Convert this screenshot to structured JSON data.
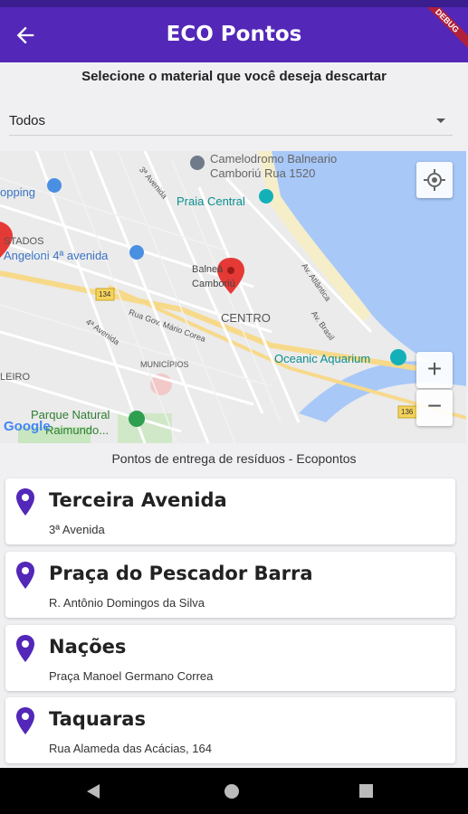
{
  "app": {
    "title": "ECO Pontos",
    "debug_banner": "DEBUG",
    "accent_color": "#5327b8",
    "pin_color": "#5327b8"
  },
  "header": {
    "back_icon": "arrow-back-icon"
  },
  "filter": {
    "prompt": "Selecione o material que você deseja descartar",
    "selected": "Todos"
  },
  "map": {
    "labels": {
      "camelodromo": "Camelodromo Balneario",
      "camelodromo2": "Camboriú Rua 1520",
      "praia": "Praia Central",
      "shopping": "opping",
      "angeloni": "Angeloni 4ª avenida",
      "estados": "STADOS",
      "balneario": "Balneá",
      "camboriu": "Camboriú",
      "centro": "CENTRO",
      "avenida3": "3ª Avenida",
      "avenida4": "4ª Avenida",
      "municipios": "MUNICÍPIOS",
      "ruagov": "Rua Gov. Mário Corea",
      "oceanic": "Oceanic Aquarium",
      "parque": "Parque Natural",
      "raimundo": "Raimundo...",
      "ileiro": "LEIRO",
      "atlantica": "Av. Atlântica",
      "brasil": "Av. Brasil",
      "r134": "134",
      "r136": "136",
      "google": "Google"
    },
    "zoom_in": "+",
    "zoom_out": "−",
    "locate_icon": "my-location-icon"
  },
  "list": {
    "heading": "Pontos de entrega de resíduos - Ecopontos",
    "items": [
      {
        "name": "Terceira Avenida",
        "address": "3ª Avenida"
      },
      {
        "name": "Praça do Pescador Barra",
        "address": "R. Antônio Domingos da Silva"
      },
      {
        "name": "Nações",
        "address": "Praça Manoel Germano Correa"
      },
      {
        "name": "Taquaras",
        "address": "Rua Alameda das Acácias, 164"
      }
    ]
  }
}
